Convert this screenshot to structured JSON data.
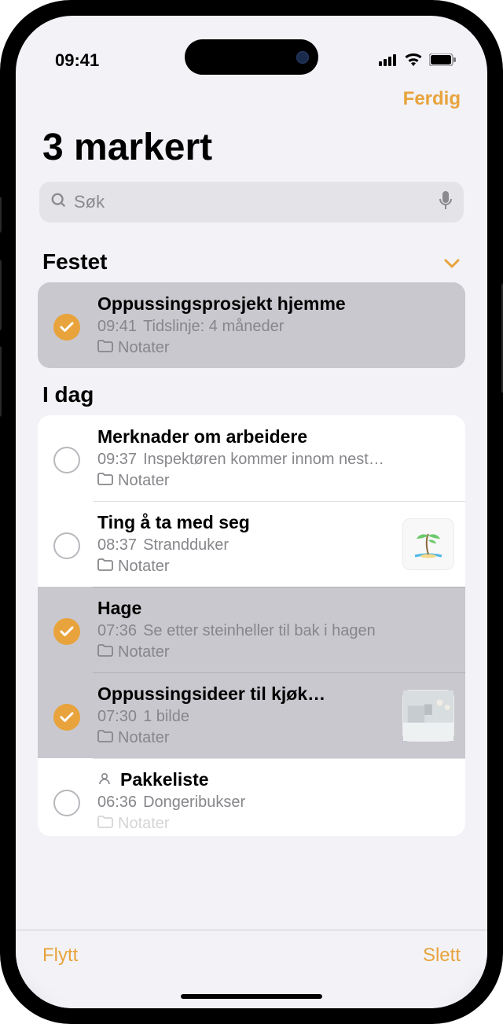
{
  "status": {
    "time": "09:41"
  },
  "nav": {
    "done": "Ferdig"
  },
  "title": "3 markert",
  "search": {
    "placeholder": "Søk"
  },
  "sections": {
    "pinned": {
      "label": "Festet"
    },
    "today": {
      "label": "I dag"
    }
  },
  "pinned": [
    {
      "selected": true,
      "title": "Oppussingsprosjekt hjemme",
      "time": "09:41",
      "preview": "Tidslinje: 4 måneder",
      "folder": "Notater"
    }
  ],
  "today": [
    {
      "selected": false,
      "title": "Merknader om arbeidere",
      "time": "09:37",
      "preview": "Inspektøren kommer innom nest…",
      "folder": "Notater"
    },
    {
      "selected": false,
      "title": "Ting å ta med seg",
      "time": "08:37",
      "preview": "Strandduker",
      "folder": "Notater",
      "thumb": "island"
    },
    {
      "selected": true,
      "title": "Hage",
      "time": "07:36",
      "preview": "Se etter steinheller til bak i hagen",
      "folder": "Notater"
    },
    {
      "selected": true,
      "title": "Oppussingsideer til kjøk…",
      "time": "07:30",
      "preview": "1 bilde",
      "folder": "Notater",
      "thumb": "kitchen"
    },
    {
      "selected": false,
      "shared": true,
      "title": "Pakkeliste",
      "time": "06:36",
      "preview": "Dongeribukser",
      "folder": "Notater"
    }
  ],
  "toolbar": {
    "move": "Flytt",
    "delete": "Slett"
  }
}
